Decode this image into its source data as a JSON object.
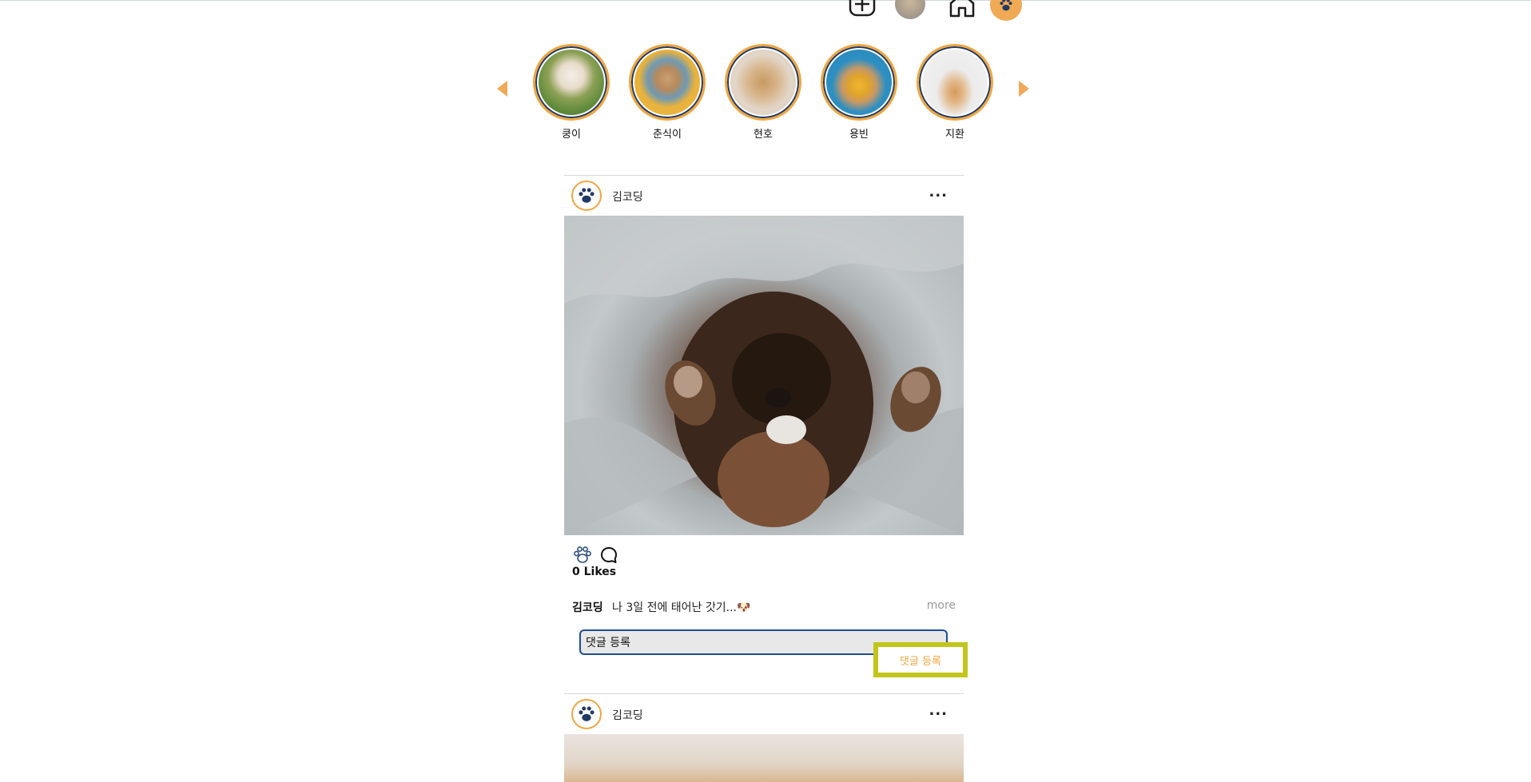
{
  "nav": {
    "icons": [
      "add-icon",
      "avatar",
      "home-icon",
      "paw-icon"
    ]
  },
  "stories": [
    {
      "name": "쿵이",
      "color": "#5f8a3a"
    },
    {
      "name": "춘식이",
      "color": "#e9b23d"
    },
    {
      "name": "현호",
      "color": "#d9cdbf"
    },
    {
      "name": "용빈",
      "color": "#2d8fc2"
    },
    {
      "name": "지환",
      "color": "#ececec"
    }
  ],
  "posts": [
    {
      "user": "김코딩",
      "more": "...",
      "likes": "0 Likes",
      "caption_user": "김코딩",
      "caption_text": "나 3일 전에 태어난 갓기...🐶",
      "caption_more": "more",
      "comment_value": "댓글 등록",
      "comment_button": "댓글 등록"
    },
    {
      "user": "김코딩",
      "more": "..."
    }
  ],
  "colors": {
    "accent": "#f0a640",
    "navy": "#1f3a64",
    "highlight": "#c2c61c"
  }
}
